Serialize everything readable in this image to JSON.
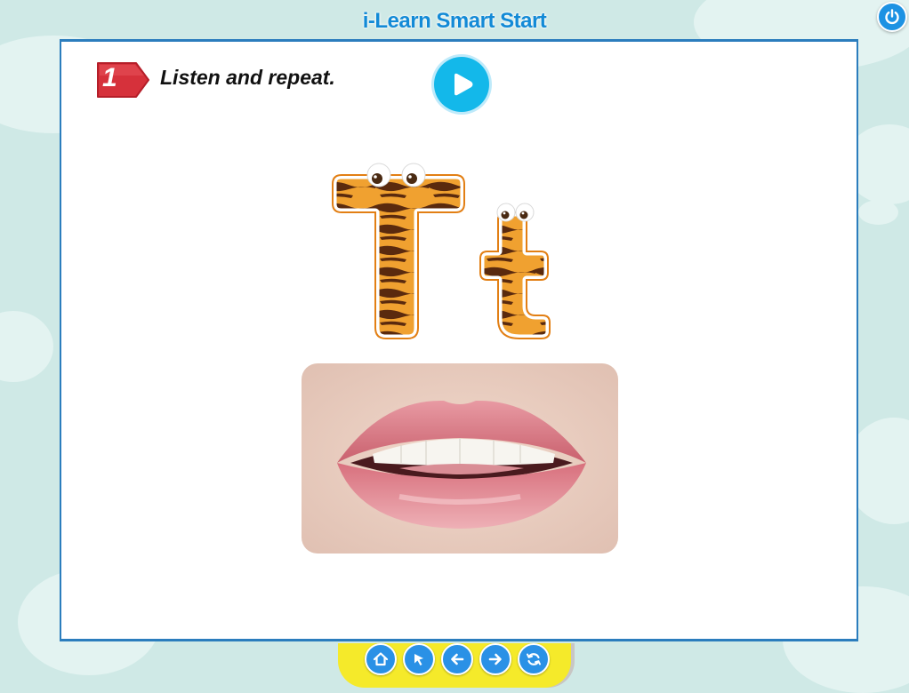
{
  "app": {
    "title": "i-Learn Smart Start"
  },
  "activity": {
    "number": "1",
    "instruction": "Listen and repeat.",
    "letters": {
      "upper": "T",
      "lower": "t"
    }
  },
  "icons": {
    "power": "power-icon",
    "play": "play-icon",
    "home": "home-icon",
    "cursor": "cursor-arrow-icon",
    "back": "arrow-left-icon",
    "forward": "arrow-right-icon",
    "refresh": "refresh-icon"
  },
  "colors": {
    "accent": "#1d92e3",
    "frame": "#2b7dbd",
    "play": "#13b8ea",
    "badge": "#d6313b",
    "nav_bar": "#f5ea2a",
    "tiger_orange": "#f0a130",
    "tiger_stripe": "#5a2a0e"
  }
}
